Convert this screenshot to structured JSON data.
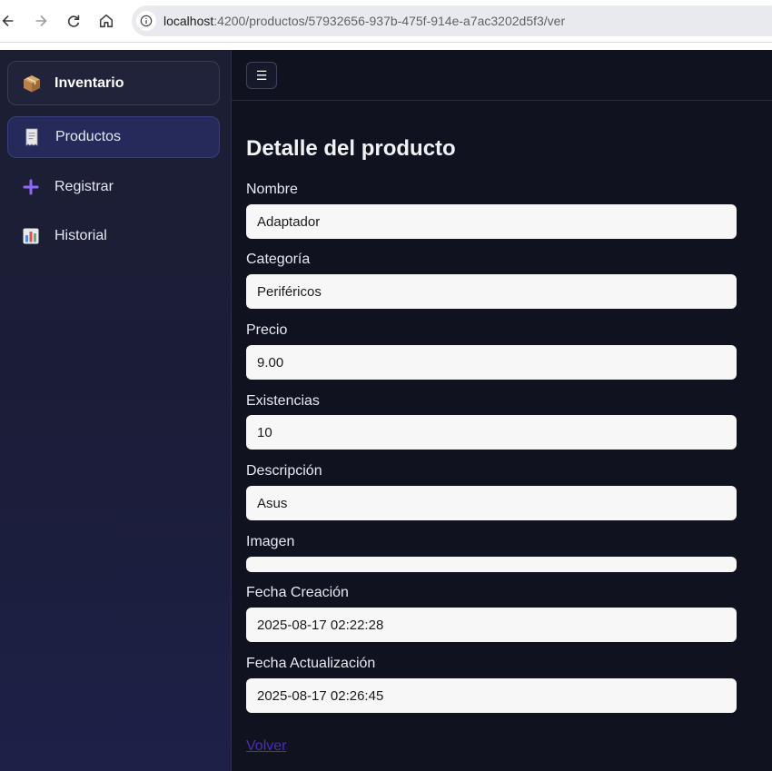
{
  "browser": {
    "url_host": "localhost",
    "url_path": ":4200/productos/57932656-937b-475f-914e-a7ac3202d5f3/ver"
  },
  "sidebar": {
    "brand": {
      "label": "Inventario",
      "icon": "package-icon"
    },
    "items": [
      {
        "label": "Productos",
        "icon": "receipt-icon",
        "active": true
      },
      {
        "label": "Registrar",
        "icon": "plus-icon",
        "active": false
      },
      {
        "label": "Historial",
        "icon": "bar-chart-icon",
        "active": false
      }
    ]
  },
  "topbar": {
    "menu_glyph": "☰"
  },
  "detail": {
    "title": "Detalle del producto",
    "fields": [
      {
        "label": "Nombre",
        "value": "Adaptador"
      },
      {
        "label": "Categoría",
        "value": "Periféricos"
      },
      {
        "label": "Precio",
        "value": "9.00"
      },
      {
        "label": "Existencias",
        "value": "10"
      },
      {
        "label": "Descripción",
        "value": "Asus"
      },
      {
        "label": "Imagen",
        "value": ""
      },
      {
        "label": "Fecha Creación",
        "value": "2025-08-17 02:22:28"
      },
      {
        "label": "Fecha Actualización",
        "value": "2025-08-17 02:26:45"
      }
    ],
    "back_label": "Volver"
  },
  "colors": {
    "sidebar_bg": "#1c1e33",
    "main_bg": "#10131f",
    "active_item_bg": "#262a5a",
    "accent_purple": "#7b5cf0",
    "link_color": "#4a2fb3"
  }
}
